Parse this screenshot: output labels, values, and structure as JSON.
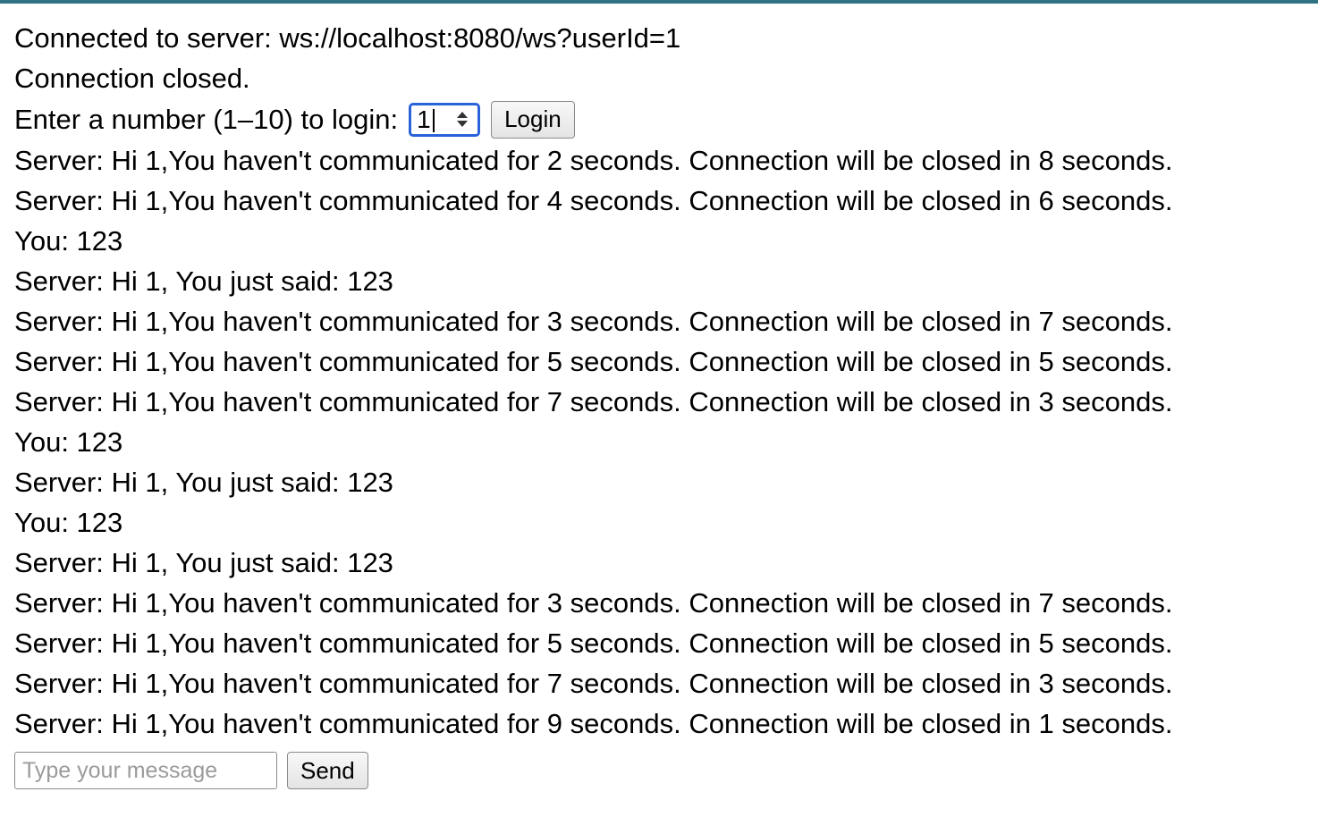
{
  "status": {
    "connected": "Connected to server: ws://localhost:8080/ws?userId=1",
    "closed": "Connection closed."
  },
  "login": {
    "label": "Enter a number (1–10) to login:",
    "value": "1",
    "button_label": "Login"
  },
  "messages": [
    "Server: Hi 1,You haven't communicated for 2 seconds. Connection will be closed in 8 seconds.",
    "Server: Hi 1,You haven't communicated for 4 seconds. Connection will be closed in 6 seconds.",
    "You: 123",
    "Server: Hi 1, You just said: 123",
    "Server: Hi 1,You haven't communicated for 3 seconds. Connection will be closed in 7 seconds.",
    "Server: Hi 1,You haven't communicated for 5 seconds. Connection will be closed in 5 seconds.",
    "Server: Hi 1,You haven't communicated for 7 seconds. Connection will be closed in 3 seconds.",
    "You: 123",
    "Server: Hi 1, You just said: 123",
    "You: 123",
    "Server: Hi 1, You just said: 123",
    "Server: Hi 1,You haven't communicated for 3 seconds. Connection will be closed in 7 seconds.",
    "Server: Hi 1,You haven't communicated for 5 seconds. Connection will be closed in 5 seconds.",
    "Server: Hi 1,You haven't communicated for 7 seconds. Connection will be closed in 3 seconds.",
    "Server: Hi 1,You haven't communicated for 9 seconds. Connection will be closed in 1 seconds."
  ],
  "composer": {
    "placeholder": "Type your message",
    "value": "",
    "send_label": "Send"
  },
  "colors": {
    "accent_bar": "#2e7283",
    "focus_ring": "#2962d9"
  }
}
